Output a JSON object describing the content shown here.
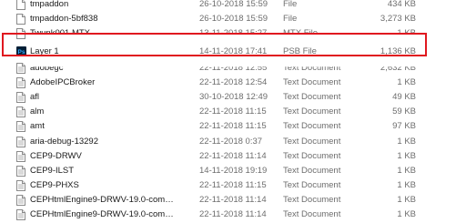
{
  "colors": {
    "highlight": "#e0181f",
    "psb_icon": "#001e36",
    "psb_text": "#31a8ff"
  },
  "files": [
    {
      "name": "tmpaddon",
      "date": "26-10-2018 15:59",
      "type": "File",
      "size": "434 KB",
      "icon": "file-icon"
    },
    {
      "name": "tmpaddon-5bf838",
      "date": "26-10-2018 15:59",
      "type": "File",
      "size": "3,273 KB",
      "icon": "file-icon"
    },
    {
      "name": "Twunk001.MTX",
      "date": "13-11-2018 15:27",
      "type": "MTX File",
      "size": "1 KB",
      "icon": "file-icon"
    },
    {
      "name": "Layer 1",
      "date": "14-11-2018 17:41",
      "type": "PSB File",
      "size": "1,136 KB",
      "icon": "photoshop-icon"
    },
    {
      "name": "adobegc",
      "date": "22-11-2018 12:55",
      "type": "Text Document",
      "size": "2,632 KB",
      "icon": "text-document-icon"
    },
    {
      "name": "AdobeIPCBroker",
      "date": "22-11-2018 12:54",
      "type": "Text Document",
      "size": "1 KB",
      "icon": "text-document-icon"
    },
    {
      "name": "afl",
      "date": "30-10-2018 12:49",
      "type": "Text Document",
      "size": "49 KB",
      "icon": "text-document-icon"
    },
    {
      "name": "alm",
      "date": "22-11-2018 11:15",
      "type": "Text Document",
      "size": "59 KB",
      "icon": "text-document-icon"
    },
    {
      "name": "amt",
      "date": "22-11-2018 11:15",
      "type": "Text Document",
      "size": "97 KB",
      "icon": "text-document-icon"
    },
    {
      "name": "aria-debug-13292",
      "date": "22-11-2018 0:37",
      "type": "Text Document",
      "size": "1 KB",
      "icon": "text-document-icon"
    },
    {
      "name": "CEP9-DRWV",
      "date": "22-11-2018 11:14",
      "type": "Text Document",
      "size": "1 KB",
      "icon": "text-document-icon"
    },
    {
      "name": "CEP9-ILST",
      "date": "14-11-2018 19:19",
      "type": "Text Document",
      "size": "1 KB",
      "icon": "text-document-icon"
    },
    {
      "name": "CEP9-PHXS",
      "date": "22-11-2018 11:15",
      "type": "Text Document",
      "size": "1 KB",
      "icon": "text-document-icon"
    },
    {
      "name": "CEPHtmlEngine9-DRWV-19.0-com.adob...",
      "date": "22-11-2018 11:14",
      "type": "Text Document",
      "size": "1 KB",
      "icon": "text-document-icon"
    },
    {
      "name": "CEPHtmlEngine9-DRWV-19.0-com.adob...",
      "date": "22-11-2018 11:14",
      "type": "Text Document",
      "size": "1 KB",
      "icon": "text-document-icon"
    }
  ]
}
